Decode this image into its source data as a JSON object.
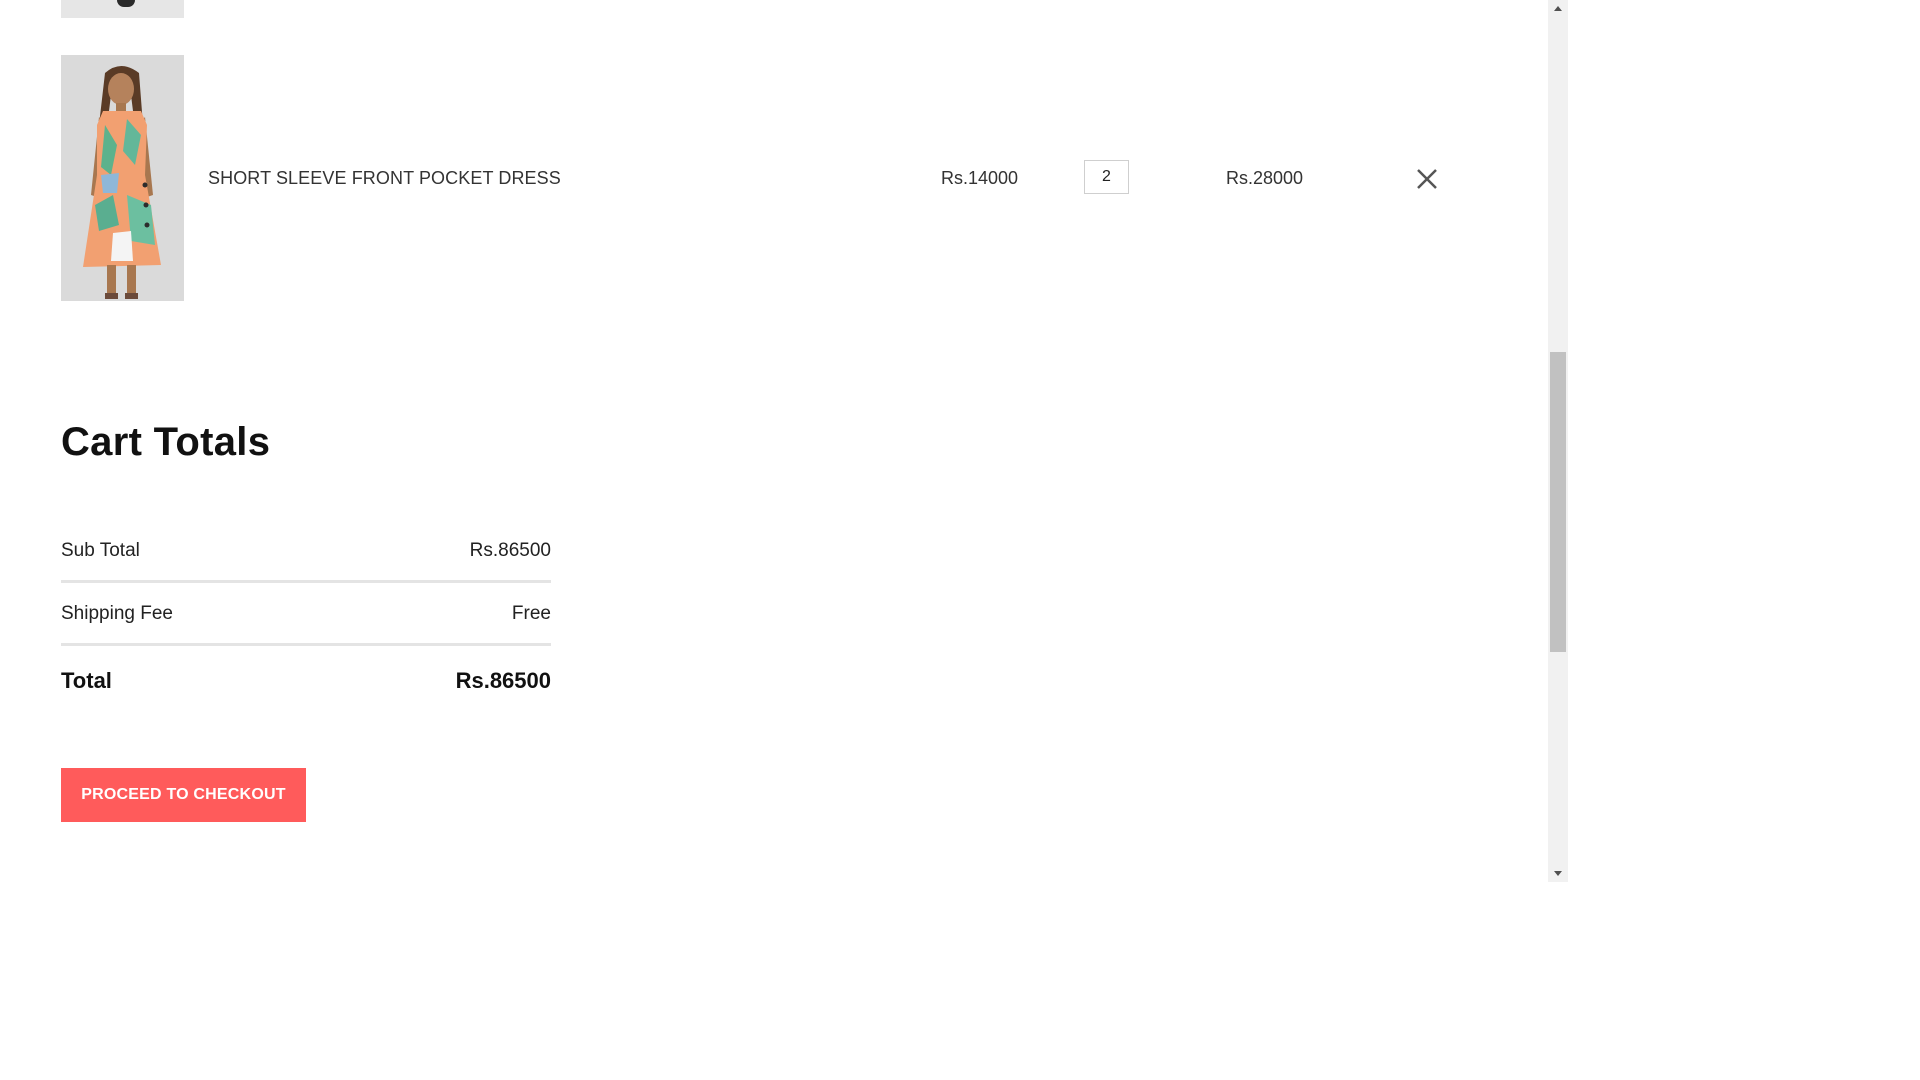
{
  "cart": {
    "items": [
      {
        "name": "SHORT SLEEVE FRONT POCKET DRESS",
        "unit_price": "Rs.14000",
        "quantity": "2",
        "line_total": "Rs.28000"
      }
    ]
  },
  "totals": {
    "title": "Cart Totals",
    "subtotal_label": "Sub Total",
    "subtotal_value": "Rs.86500",
    "shipping_label": "Shipping Fee",
    "shipping_value": "Free",
    "total_label": "Total",
    "total_value": "Rs.86500"
  },
  "actions": {
    "checkout_label": "PROCEED TO CHECKOUT"
  },
  "icons": {
    "remove": "close-icon",
    "scroll_up": "caret-up-icon",
    "scroll_down": "caret-down-icon"
  },
  "colors": {
    "accent": "#ff5b5b",
    "divider": "#e4e4e4"
  }
}
